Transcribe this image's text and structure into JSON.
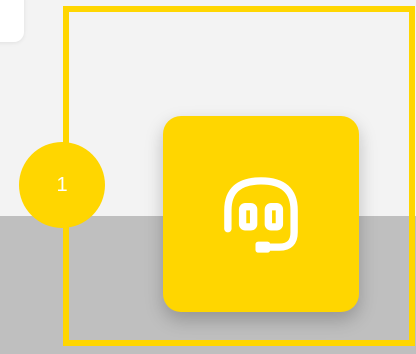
{
  "colors": {
    "accent": "#ffd600",
    "top_background": "#f3f3f3",
    "bottom_background": "#bfbfbf",
    "icon": "#ffffff"
  },
  "tour": {
    "step_number": "1"
  },
  "support_button": {
    "icon": "headset-icon"
  }
}
